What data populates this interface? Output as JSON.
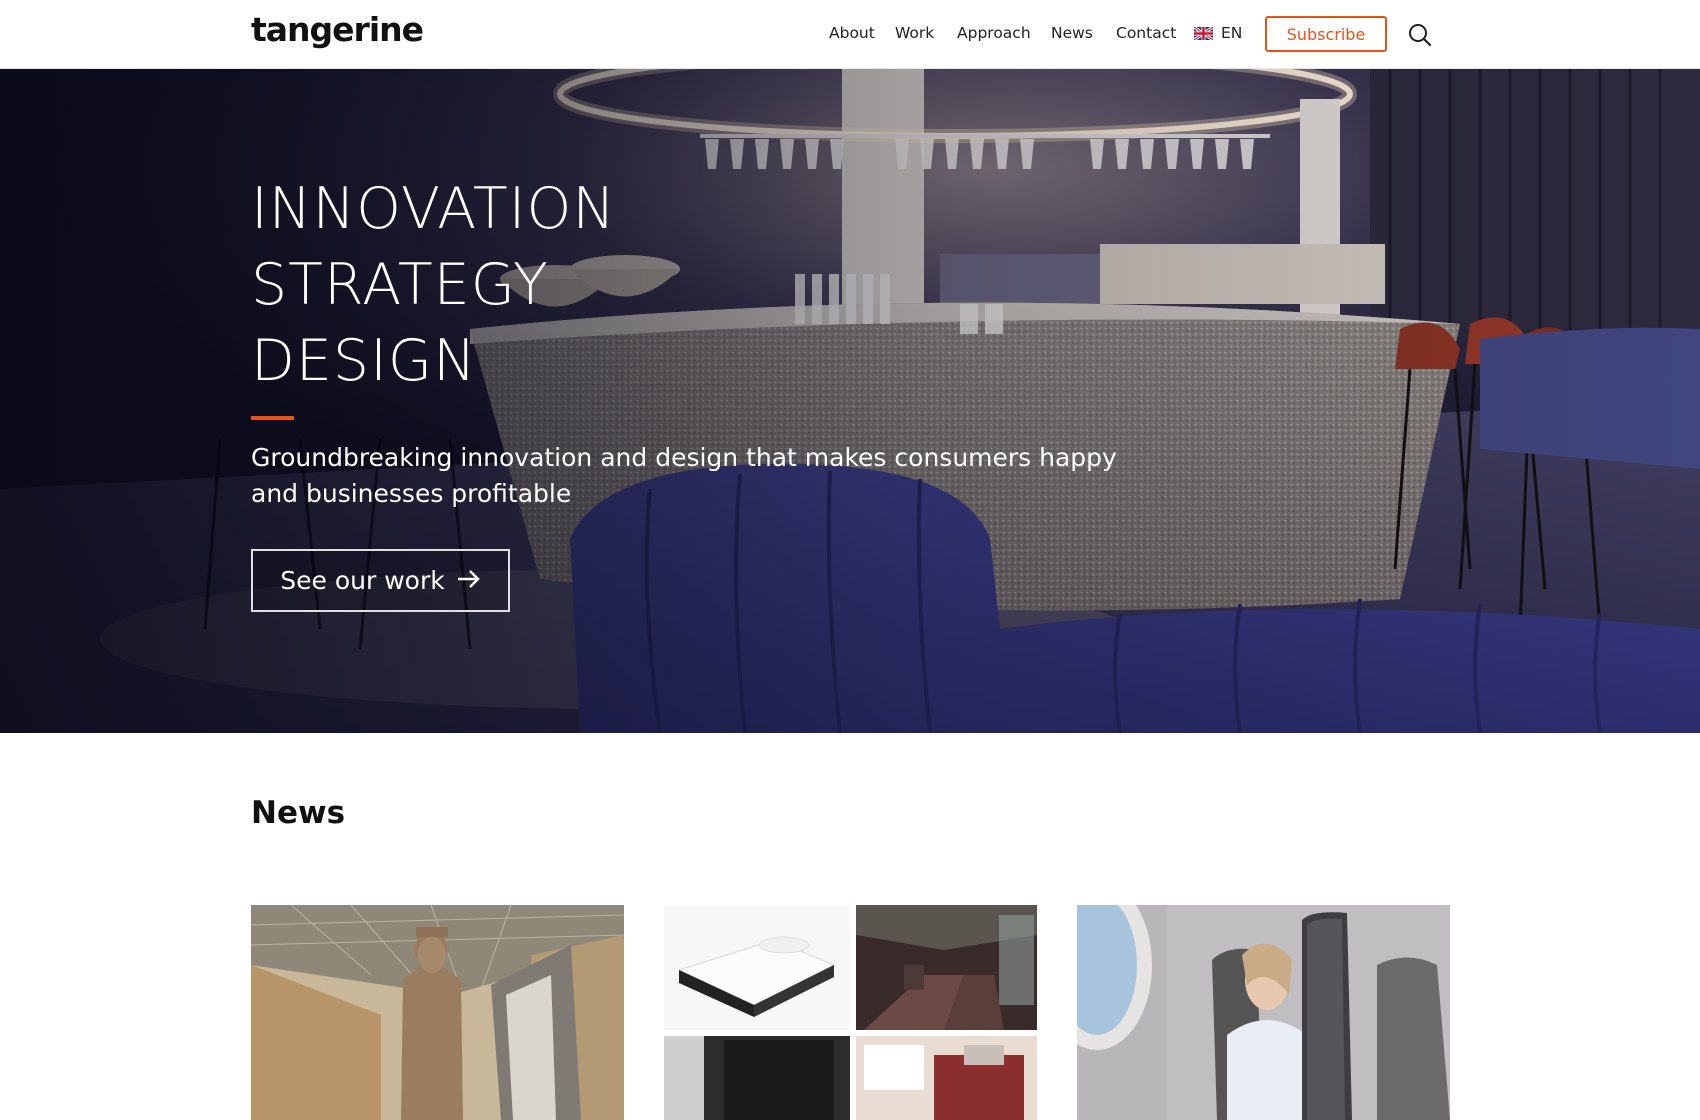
{
  "brand": {
    "logo": "tangerine",
    "accent_color": "#e8521b"
  },
  "nav": {
    "items": [
      "About",
      "Work",
      "Approach",
      "News",
      "Contact"
    ],
    "language": "EN",
    "language_flag": "uk-flag-icon",
    "subscribe_label": "Subscribe",
    "search_icon": "search-icon"
  },
  "hero": {
    "title_lines": [
      "INNOVATION",
      "STRATEGY",
      "DESIGN"
    ],
    "subtitle": "Groundbreaking innovation and design that makes consumers happy and businesses profitable",
    "cta_label": "See our work",
    "cta_icon": "arrow-right-icon"
  },
  "news": {
    "heading": "News",
    "cards": [
      {
        "image": "museum-statue-image"
      },
      {
        "image": "train-interior-collage-image"
      },
      {
        "image": "aircraft-seat-image"
      }
    ]
  }
}
